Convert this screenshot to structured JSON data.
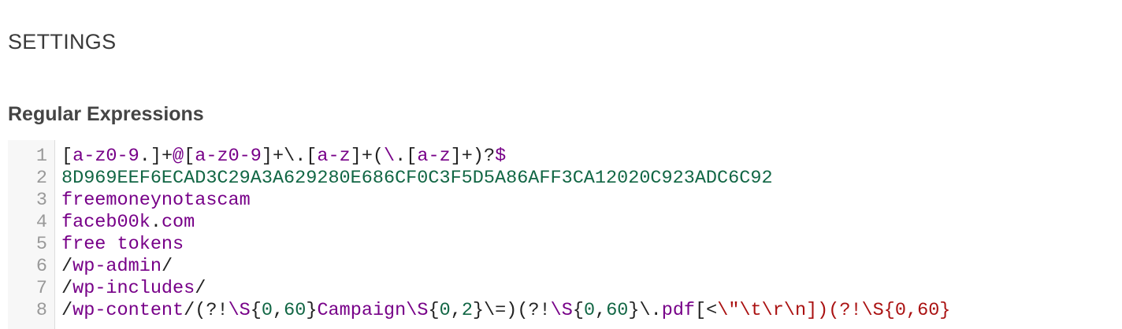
{
  "page": {
    "title": "SETTINGS",
    "section_label": "Regular Expressions"
  },
  "colors": {
    "keyword": "#770088",
    "plain": "#222222",
    "number": "#116644",
    "string": "#aa1111",
    "gutter_bg": "#f7f7f7",
    "line_number": "#999999"
  },
  "editor": {
    "lines": [
      {
        "number": "1",
        "tokens": [
          {
            "text": "[",
            "color": "black"
          },
          {
            "text": "a-z0-9",
            "color": "purple"
          },
          {
            "text": ".]+",
            "color": "black"
          },
          {
            "text": "@",
            "color": "purple"
          },
          {
            "text": "[",
            "color": "black"
          },
          {
            "text": "a-z0-9",
            "color": "purple"
          },
          {
            "text": "]+\\.[",
            "color": "black"
          },
          {
            "text": "a-z",
            "color": "purple"
          },
          {
            "text": "]+(",
            "color": "black"
          },
          {
            "text": "\\",
            "color": "purple"
          },
          {
            "text": ".[",
            "color": "black"
          },
          {
            "text": "a-z",
            "color": "purple"
          },
          {
            "text": "]+)?",
            "color": "black"
          },
          {
            "text": "$",
            "color": "purple"
          }
        ]
      },
      {
        "number": "2",
        "tokens": [
          {
            "text": "8D969EEF6ECAD3C29A3A629280E686CF0C3F5D5A86AFF3CA12020C923ADC6C92",
            "color": "green"
          }
        ]
      },
      {
        "number": "3",
        "tokens": [
          {
            "text": "freemoneynotascam",
            "color": "purple"
          }
        ]
      },
      {
        "number": "4",
        "tokens": [
          {
            "text": "faceb00k",
            "color": "purple"
          },
          {
            "text": ".",
            "color": "black"
          },
          {
            "text": "com",
            "color": "purple"
          }
        ]
      },
      {
        "number": "5",
        "tokens": [
          {
            "text": "free tokens",
            "color": "purple"
          }
        ]
      },
      {
        "number": "6",
        "tokens": [
          {
            "text": "/",
            "color": "black"
          },
          {
            "text": "wp-admin",
            "color": "purple"
          },
          {
            "text": "/",
            "color": "black"
          }
        ]
      },
      {
        "number": "7",
        "tokens": [
          {
            "text": "/",
            "color": "black"
          },
          {
            "text": "wp-includes",
            "color": "purple"
          },
          {
            "text": "/",
            "color": "black"
          }
        ]
      },
      {
        "number": "8",
        "tokens": [
          {
            "text": "/",
            "color": "black"
          },
          {
            "text": "wp-content",
            "color": "purple"
          },
          {
            "text": "/(?!",
            "color": "black"
          },
          {
            "text": "\\S",
            "color": "purple"
          },
          {
            "text": "{",
            "color": "black"
          },
          {
            "text": "0",
            "color": "green"
          },
          {
            "text": ",",
            "color": "black"
          },
          {
            "text": "60",
            "color": "green"
          },
          {
            "text": "}",
            "color": "black"
          },
          {
            "text": "Campaign",
            "color": "purple"
          },
          {
            "text": "\\S",
            "color": "purple"
          },
          {
            "text": "{",
            "color": "black"
          },
          {
            "text": "0",
            "color": "green"
          },
          {
            "text": ",",
            "color": "black"
          },
          {
            "text": "2",
            "color": "green"
          },
          {
            "text": "}\\=)(?!",
            "color": "black"
          },
          {
            "text": "\\S",
            "color": "purple"
          },
          {
            "text": "{",
            "color": "black"
          },
          {
            "text": "0",
            "color": "green"
          },
          {
            "text": ",",
            "color": "black"
          },
          {
            "text": "60",
            "color": "green"
          },
          {
            "text": "}\\.",
            "color": "black"
          },
          {
            "text": "pdf",
            "color": "purple"
          },
          {
            "text": "[<",
            "color": "black"
          },
          {
            "text": "\\\"\\t\\r\\n])(?!\\S{0,60}",
            "color": "red"
          }
        ]
      }
    ]
  }
}
